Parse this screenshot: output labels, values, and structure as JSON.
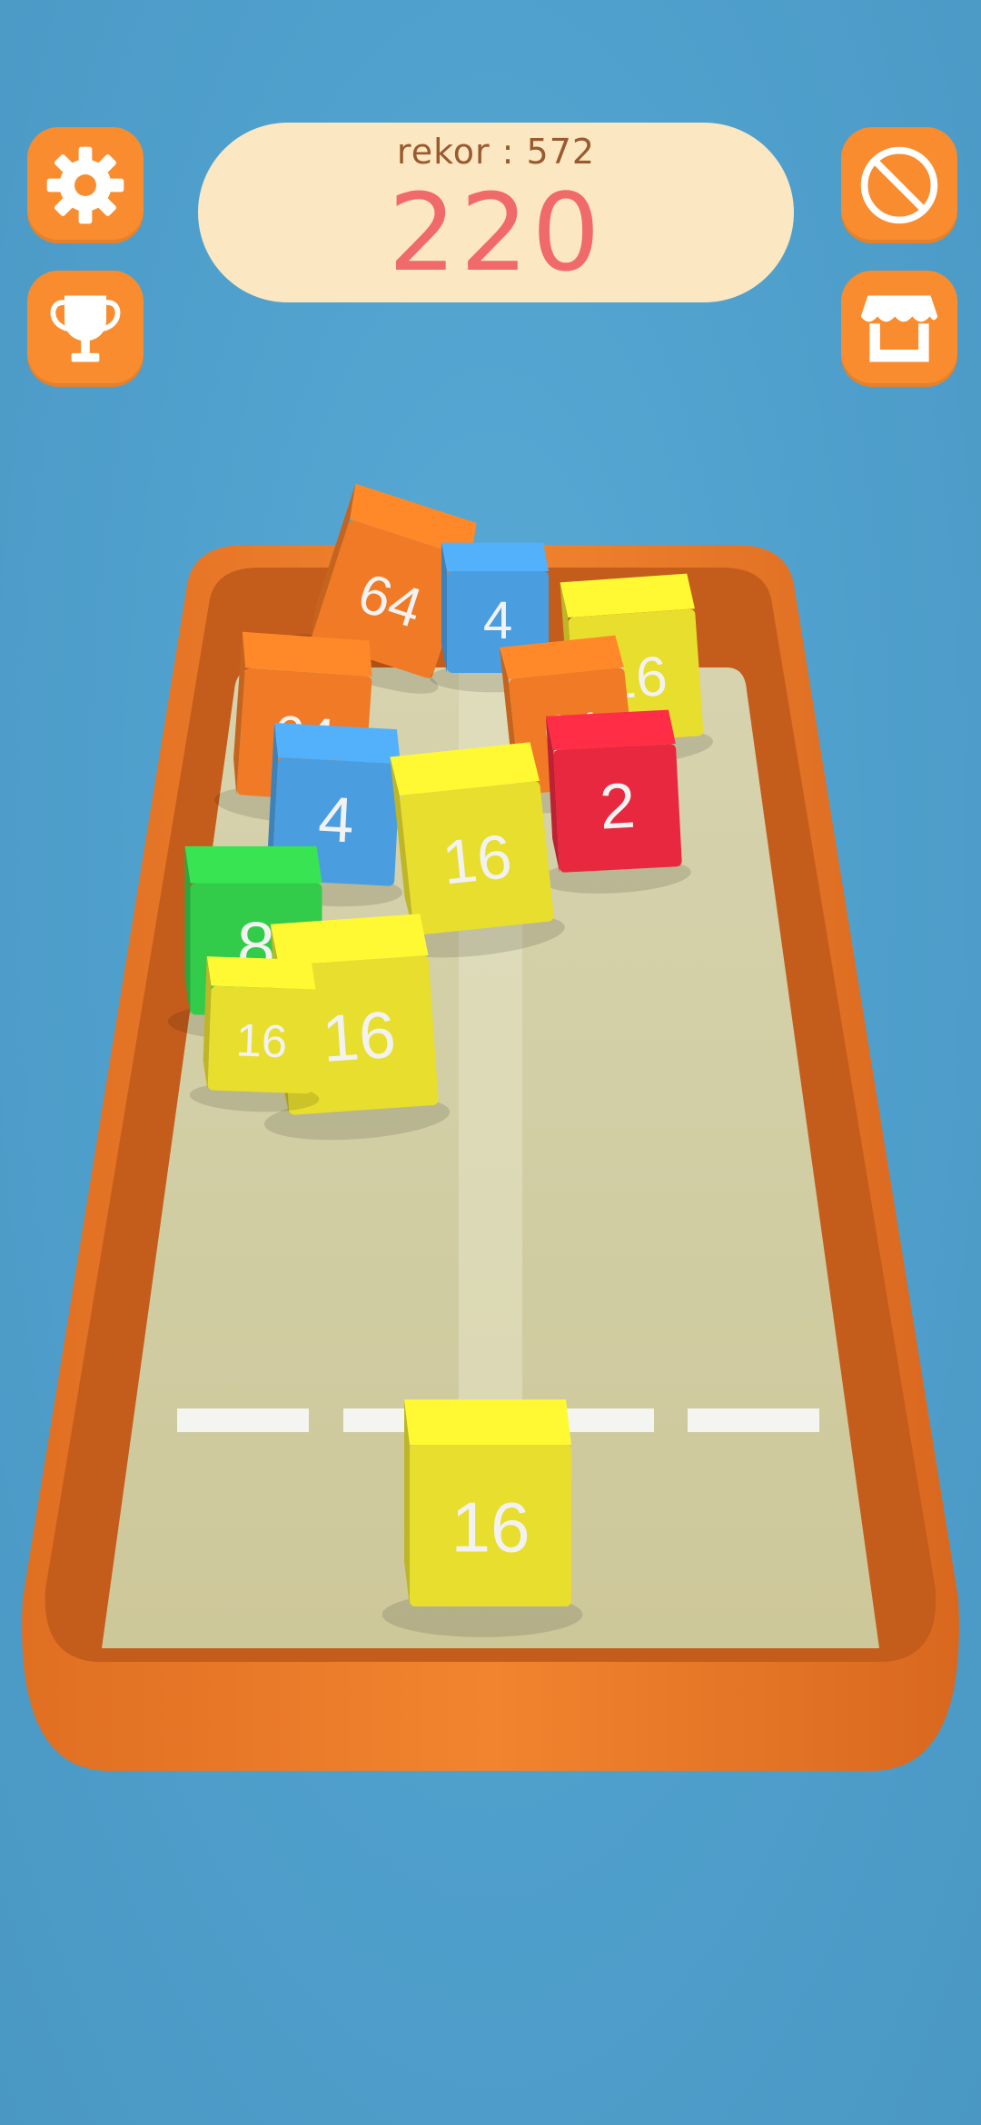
{
  "hud": {
    "record_label": "rekor : 572",
    "score": "220"
  },
  "buttons": {
    "settings": {
      "icon": "gear-icon"
    },
    "leaderboard": {
      "icon": "trophy-icon"
    },
    "no_ads": {
      "icon": "no-ads-icon"
    },
    "shop": {
      "icon": "shop-icon"
    }
  },
  "board": {
    "cubes": [
      {
        "value": "64",
        "color": "#f07a25"
      },
      {
        "value": "4",
        "color": "#4a9ee0"
      },
      {
        "value": "16",
        "color": "#e8de2e"
      },
      {
        "value": "64",
        "color": "#f07a25"
      },
      {
        "value": "64",
        "color": "#f07a25"
      },
      {
        "value": "2",
        "color": "#e8283e"
      },
      {
        "value": "4",
        "color": "#4a9ee0"
      },
      {
        "value": "16",
        "color": "#e8de2e"
      },
      {
        "value": "8",
        "color": "#33cc4a"
      },
      {
        "value": "16",
        "color": "#e8de2e"
      },
      {
        "value": "16",
        "color": "#e8de2e"
      }
    ],
    "player_cube": {
      "value": "16",
      "color": "#e8de2e"
    }
  },
  "colors": {
    "background": "#4f9fcc",
    "button": "#f98c2e",
    "tray": "#ec7a2a",
    "floor": "#d3cfa2",
    "score": "#f06a6a",
    "pill": "#fbe8c2"
  }
}
